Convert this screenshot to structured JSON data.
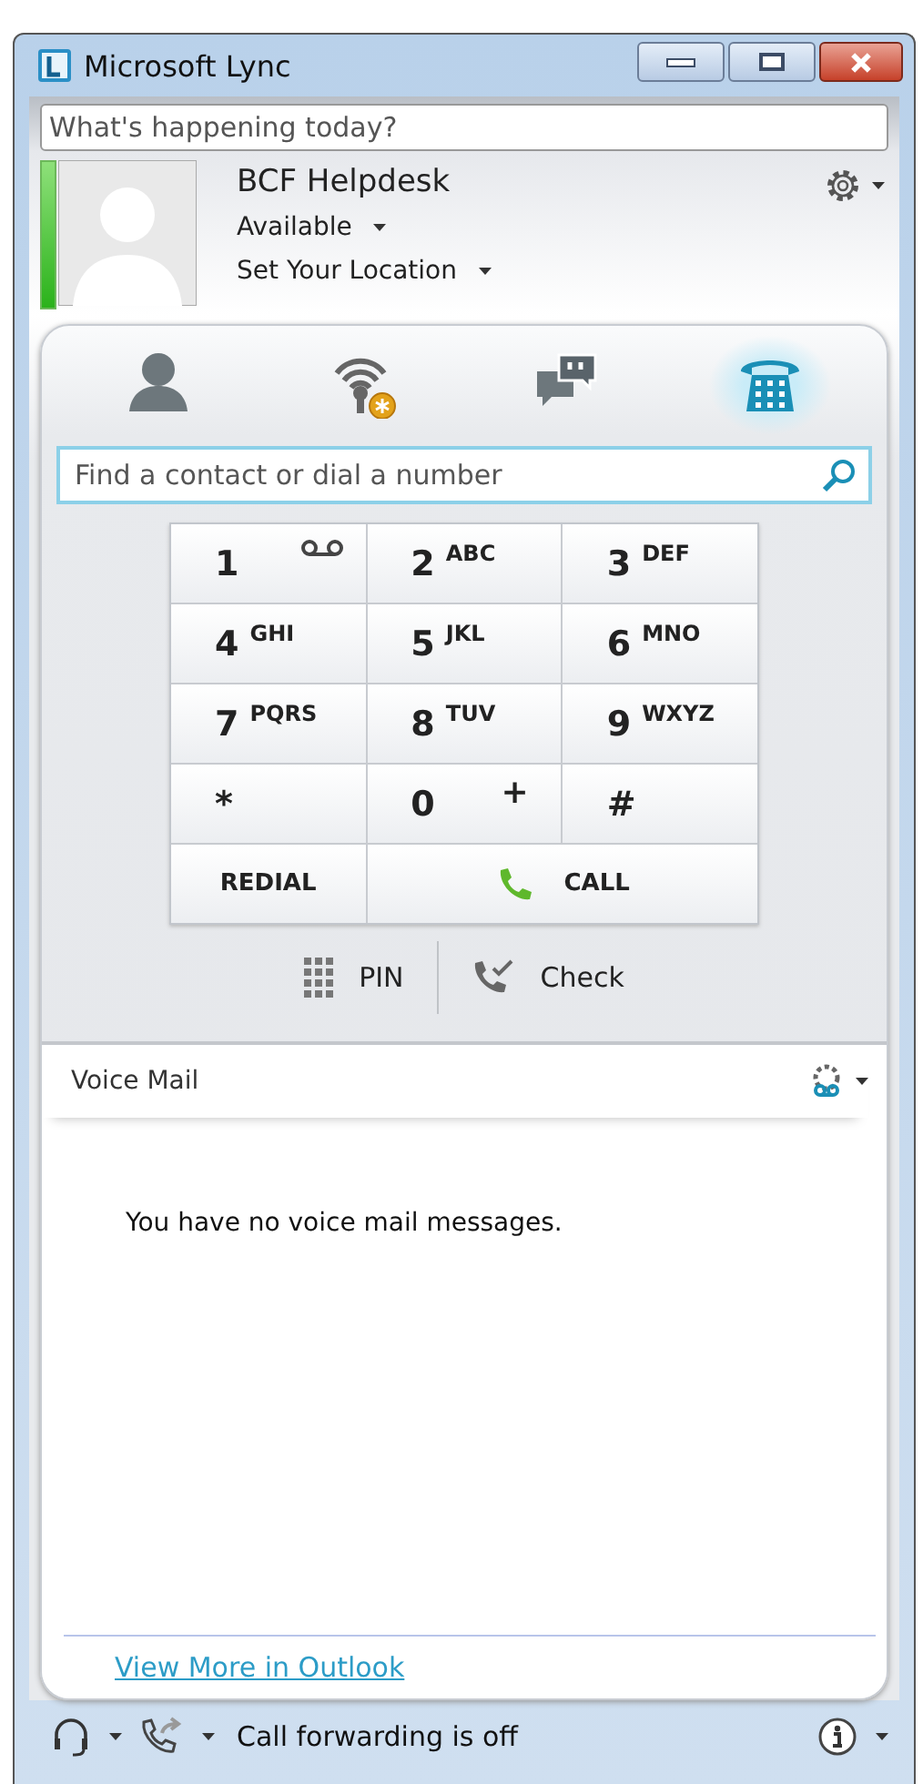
{
  "window": {
    "title": "Microsoft Lync"
  },
  "status_note": {
    "placeholder": "What's happening today?"
  },
  "profile": {
    "name": "BCF Helpdesk",
    "availability": "Available",
    "location": "Set Your Location"
  },
  "tabs": [
    {
      "kind": "contacts",
      "selected": false
    },
    {
      "kind": "status",
      "selected": false
    },
    {
      "kind": "conversations",
      "selected": false
    },
    {
      "kind": "phone",
      "selected": true
    }
  ],
  "search": {
    "placeholder": "Find a contact or dial a number"
  },
  "keypad": [
    {
      "kind": "voicemail",
      "digit": "1"
    },
    {
      "kind": "digit",
      "digit": "2",
      "letters": "ABC"
    },
    {
      "kind": "digit",
      "digit": "3",
      "letters": "DEF"
    },
    {
      "kind": "digit",
      "digit": "4",
      "letters": "GHI"
    },
    {
      "kind": "digit",
      "digit": "5",
      "letters": "JKL"
    },
    {
      "kind": "digit",
      "digit": "6",
      "letters": "MNO"
    },
    {
      "kind": "digit",
      "digit": "7",
      "letters": "PQRS"
    },
    {
      "kind": "digit",
      "digit": "8",
      "letters": "TUV"
    },
    {
      "kind": "digit",
      "digit": "9",
      "letters": "WXYZ"
    },
    {
      "kind": "symbol",
      "digit": "*"
    },
    {
      "kind": "digit",
      "digit": "0",
      "plus": "+"
    },
    {
      "kind": "symbol",
      "digit": "#"
    },
    {
      "kind": "redial",
      "label": "REDIAL"
    },
    {
      "kind": "call",
      "label": "CALL"
    }
  ],
  "actions": [
    {
      "kind": "pin",
      "label": "PIN"
    },
    {
      "kind": "check",
      "label": "Check"
    }
  ],
  "voice_mail": {
    "title": "Voice Mail",
    "message": "You have no voice mail messages.",
    "link": "View More in Outlook"
  },
  "status_bar": {
    "forwarding": "Call forwarding is off"
  }
}
